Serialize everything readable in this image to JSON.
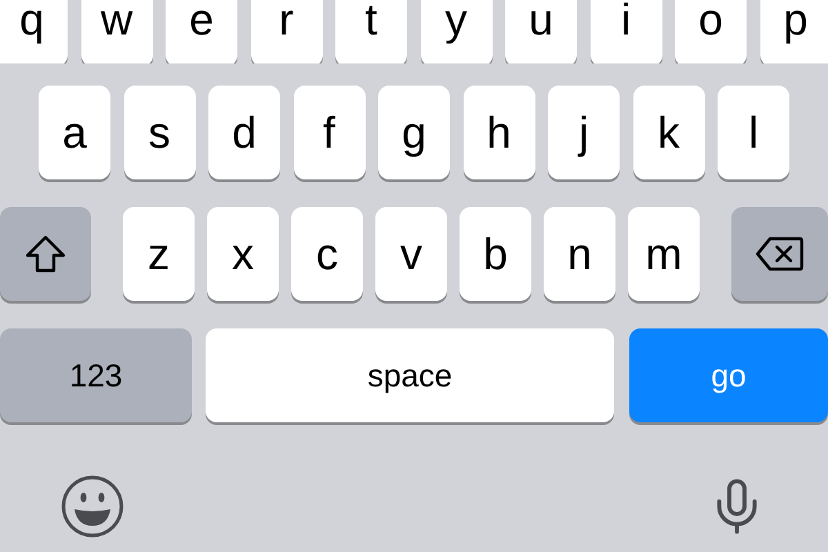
{
  "rows": [
    [
      {
        "kind": "letter",
        "label": "q"
      },
      {
        "kind": "letter",
        "label": "w"
      },
      {
        "kind": "letter",
        "label": "e"
      },
      {
        "kind": "letter",
        "label": "r"
      },
      {
        "kind": "letter",
        "label": "t"
      },
      {
        "kind": "letter",
        "label": "y"
      },
      {
        "kind": "letter",
        "label": "u"
      },
      {
        "kind": "letter",
        "label": "i"
      },
      {
        "kind": "letter",
        "label": "o"
      },
      {
        "kind": "letter",
        "label": "p"
      }
    ],
    [
      {
        "kind": "letter",
        "label": "a"
      },
      {
        "kind": "letter",
        "label": "s"
      },
      {
        "kind": "letter",
        "label": "d"
      },
      {
        "kind": "letter",
        "label": "f"
      },
      {
        "kind": "letter",
        "label": "g"
      },
      {
        "kind": "letter",
        "label": "h"
      },
      {
        "kind": "letter",
        "label": "j"
      },
      {
        "kind": "letter",
        "label": "k"
      },
      {
        "kind": "letter",
        "label": "l"
      }
    ],
    [
      {
        "kind": "shift"
      },
      {
        "kind": "letter",
        "label": "z"
      },
      {
        "kind": "letter",
        "label": "x"
      },
      {
        "kind": "letter",
        "label": "c"
      },
      {
        "kind": "letter",
        "label": "v"
      },
      {
        "kind": "letter",
        "label": "b"
      },
      {
        "kind": "letter",
        "label": "n"
      },
      {
        "kind": "letter",
        "label": "m"
      },
      {
        "kind": "delete"
      }
    ],
    [
      {
        "kind": "numbers",
        "label": "123"
      },
      {
        "kind": "space",
        "label": "space"
      },
      {
        "kind": "go",
        "label": "go"
      }
    ]
  ]
}
